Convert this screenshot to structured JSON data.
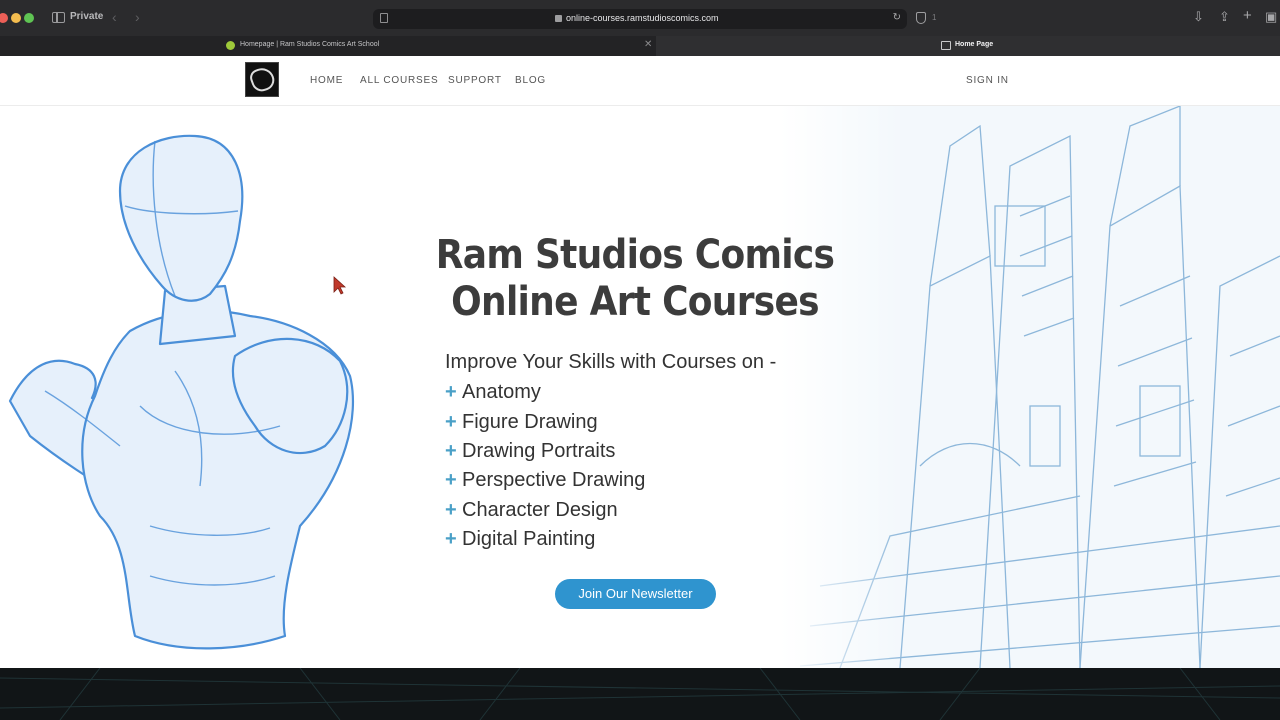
{
  "browser": {
    "private_label": "Private",
    "url": "online-courses.ramstudioscomics.com",
    "shield_count": "1",
    "tabs": [
      {
        "title": "Homepage | Ram Studios Comics Art School"
      },
      {
        "title": "Home Page"
      }
    ]
  },
  "header": {
    "nav": [
      "HOME",
      "ALL COURSES",
      "SUPPORT",
      "BLOG"
    ],
    "signin": "SIGN IN"
  },
  "hero": {
    "title_line1": "Ram Studios Comics",
    "title_line2": "Online Art Courses",
    "subtitle": "Improve Your Skills with Courses on -",
    "courses": [
      "Anatomy",
      "Figure Drawing",
      "Drawing Portraits",
      "Perspective Drawing",
      "Character Design",
      "Digital Painting"
    ],
    "button": "Join Our Newsletter"
  },
  "colors": {
    "accent": "#2f94cf",
    "plus": "#4aa0c7",
    "sketch_blue": "#4a8fd8"
  }
}
